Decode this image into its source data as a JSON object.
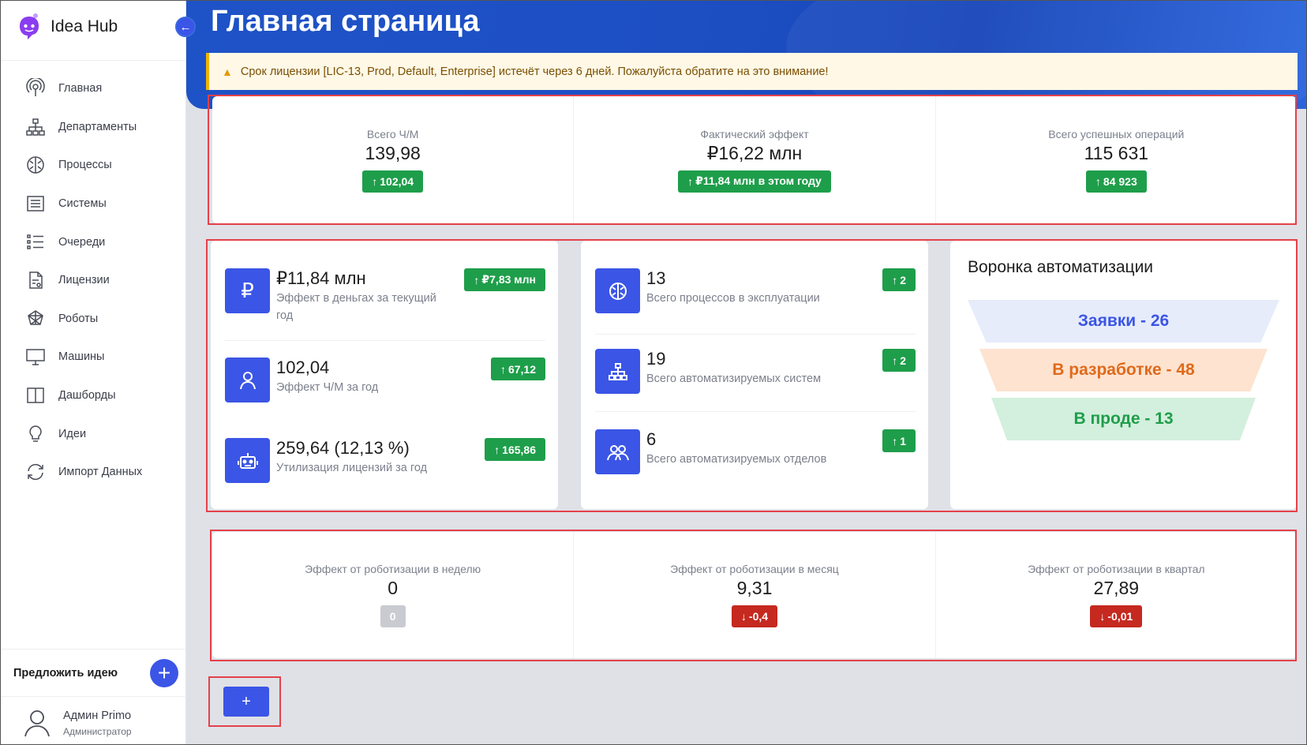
{
  "app": {
    "name": "Idea Hub",
    "page_title": "Главная страница"
  },
  "sidebar": {
    "items": [
      {
        "label": "Главная",
        "icon": "home-icon"
      },
      {
        "label": "Департаменты",
        "icon": "org-chart-icon"
      },
      {
        "label": "Процессы",
        "icon": "process-icon"
      },
      {
        "label": "Системы",
        "icon": "system-icon"
      },
      {
        "label": "Очереди",
        "icon": "queue-list-icon"
      },
      {
        "label": "Лицензии",
        "icon": "license-icon"
      },
      {
        "label": "Роботы",
        "icon": "robot-icon"
      },
      {
        "label": "Машины",
        "icon": "monitor-icon"
      },
      {
        "label": "Дашборды",
        "icon": "dashboard-icon"
      },
      {
        "label": "Идеи",
        "icon": "lightbulb-icon"
      },
      {
        "label": "Импорт Данных",
        "icon": "sync-icon"
      }
    ],
    "suggest_label": "Предложить идею",
    "user": {
      "name": "Админ Primo",
      "role": "Администратор"
    }
  },
  "alert": {
    "text": "Срок лицензии [LIC-13, Prod, Default, Enterprise] истечёт через 6 дней. Пожалуйста обратите на это внимание!"
  },
  "summary": [
    {
      "label": "Всего Ч/М",
      "value": "139,98",
      "badge": "102,04"
    },
    {
      "label": "Фактический эффект",
      "value": "₽16,22 млн",
      "badge": "₽11,84 млн в этом году"
    },
    {
      "label": "Всего успешных операций",
      "value": "115 631",
      "badge": "84 923"
    }
  ],
  "kpi_left": [
    {
      "value": "₽11,84 млн",
      "desc": "Эффект в деньгах за текущий год",
      "badge": "₽7,83 млн",
      "icon": "ruble-icon"
    },
    {
      "value": "102,04",
      "desc": "Эффект Ч/М за год",
      "badge": "67,12",
      "icon": "person-icon"
    },
    {
      "value": "259,64 (12,13 %)",
      "desc": "Утилизация лицензий за год",
      "badge": "165,86",
      "icon": "robot-icon"
    }
  ],
  "kpi_mid": [
    {
      "value": "13",
      "desc": "Всего процессов в эксплуатации",
      "badge": "2",
      "icon": "process-icon"
    },
    {
      "value": "19",
      "desc": "Всего автоматизируемых систем",
      "badge": "2",
      "icon": "org-chart-icon"
    },
    {
      "value": "6",
      "desc": "Всего автоматизируемых отделов",
      "badge": "1",
      "icon": "group-icon"
    }
  ],
  "funnel": {
    "title": "Воронка автоматизации",
    "steps": [
      {
        "label": "Заявки - 26",
        "color": "#3b55e6",
        "bg": "#e6ecfa"
      },
      {
        "label": "В разработке - 48",
        "color": "#e06a1b",
        "bg": "#fde3d0"
      },
      {
        "label": "В проде - 13",
        "color": "#1e9e4a",
        "bg": "#d3efdd"
      }
    ]
  },
  "robot_effect": [
    {
      "label": "Эффект от роботизации в неделю",
      "value": "0",
      "badge": "0",
      "trend": "none"
    },
    {
      "label": "Эффект от роботизации в месяц",
      "value": "9,31",
      "badge": "-0,4",
      "trend": "down"
    },
    {
      "label": "Эффект от роботизации в квартал",
      "value": "27,89",
      "badge": "-0,01",
      "trend": "down"
    }
  ],
  "add_widget_label": "+",
  "colors": {
    "accent": "#3b55e6",
    "up": "#1e9e4a",
    "down": "#c5291f",
    "neutral": "#c9cbd0"
  }
}
